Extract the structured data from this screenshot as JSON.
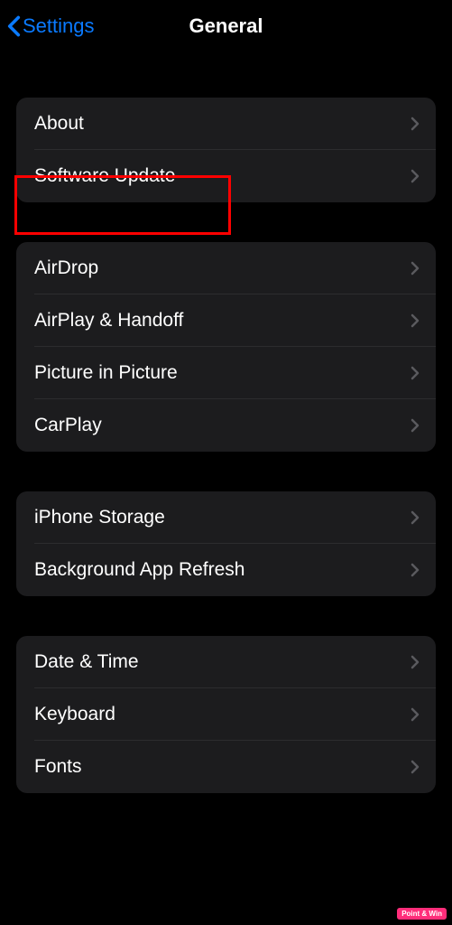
{
  "nav": {
    "back_label": "Settings",
    "title": "General"
  },
  "groups": [
    {
      "items": [
        {
          "label": "About",
          "key": "about"
        },
        {
          "label": "Software Update",
          "key": "software-update"
        }
      ]
    },
    {
      "items": [
        {
          "label": "AirDrop",
          "key": "airdrop"
        },
        {
          "label": "AirPlay & Handoff",
          "key": "airplay-handoff"
        },
        {
          "label": "Picture in Picture",
          "key": "picture-in-picture"
        },
        {
          "label": "CarPlay",
          "key": "carplay"
        }
      ]
    },
    {
      "items": [
        {
          "label": "iPhone Storage",
          "key": "iphone-storage"
        },
        {
          "label": "Background App Refresh",
          "key": "background-app-refresh"
        }
      ]
    },
    {
      "items": [
        {
          "label": "Date & Time",
          "key": "date-time"
        },
        {
          "label": "Keyboard",
          "key": "keyboard"
        },
        {
          "label": "Fonts",
          "key": "fonts"
        }
      ]
    }
  ],
  "highlighted_row": "software-update",
  "watermark": "Point & Win"
}
